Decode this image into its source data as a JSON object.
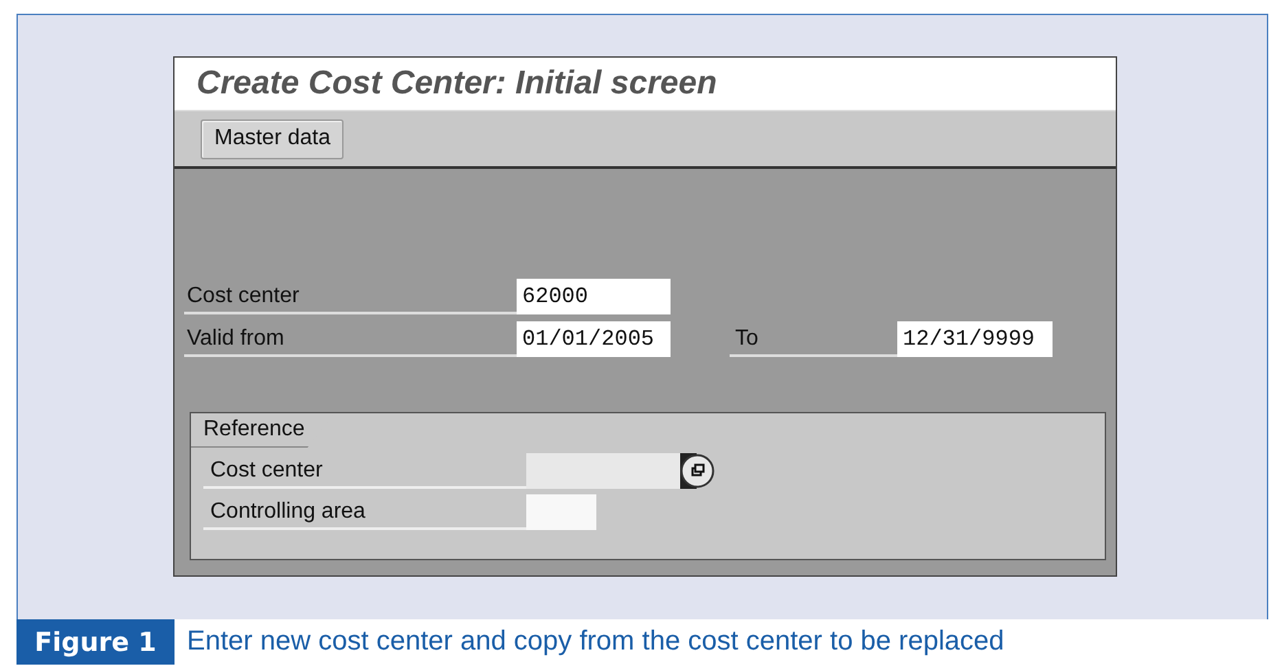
{
  "window": {
    "title": "Create Cost Center: Initial screen"
  },
  "toolbar": {
    "buttons": [
      "Master data"
    ]
  },
  "fields": [
    {
      "label": "Cost center",
      "value": "62000"
    },
    {
      "label": "Valid from",
      "value": "01/01/2005",
      "to_label": "To",
      "to_value": "12/31/9999"
    }
  ],
  "reference": {
    "title": "Reference",
    "fields": [
      {
        "label": "Cost center",
        "kind": "search"
      },
      {
        "label": "Controlling area",
        "kind": "short"
      }
    ]
  },
  "figure": {
    "label": "Figure 1",
    "caption": "Enter new cost center and copy from the cost center to be replaced"
  }
}
